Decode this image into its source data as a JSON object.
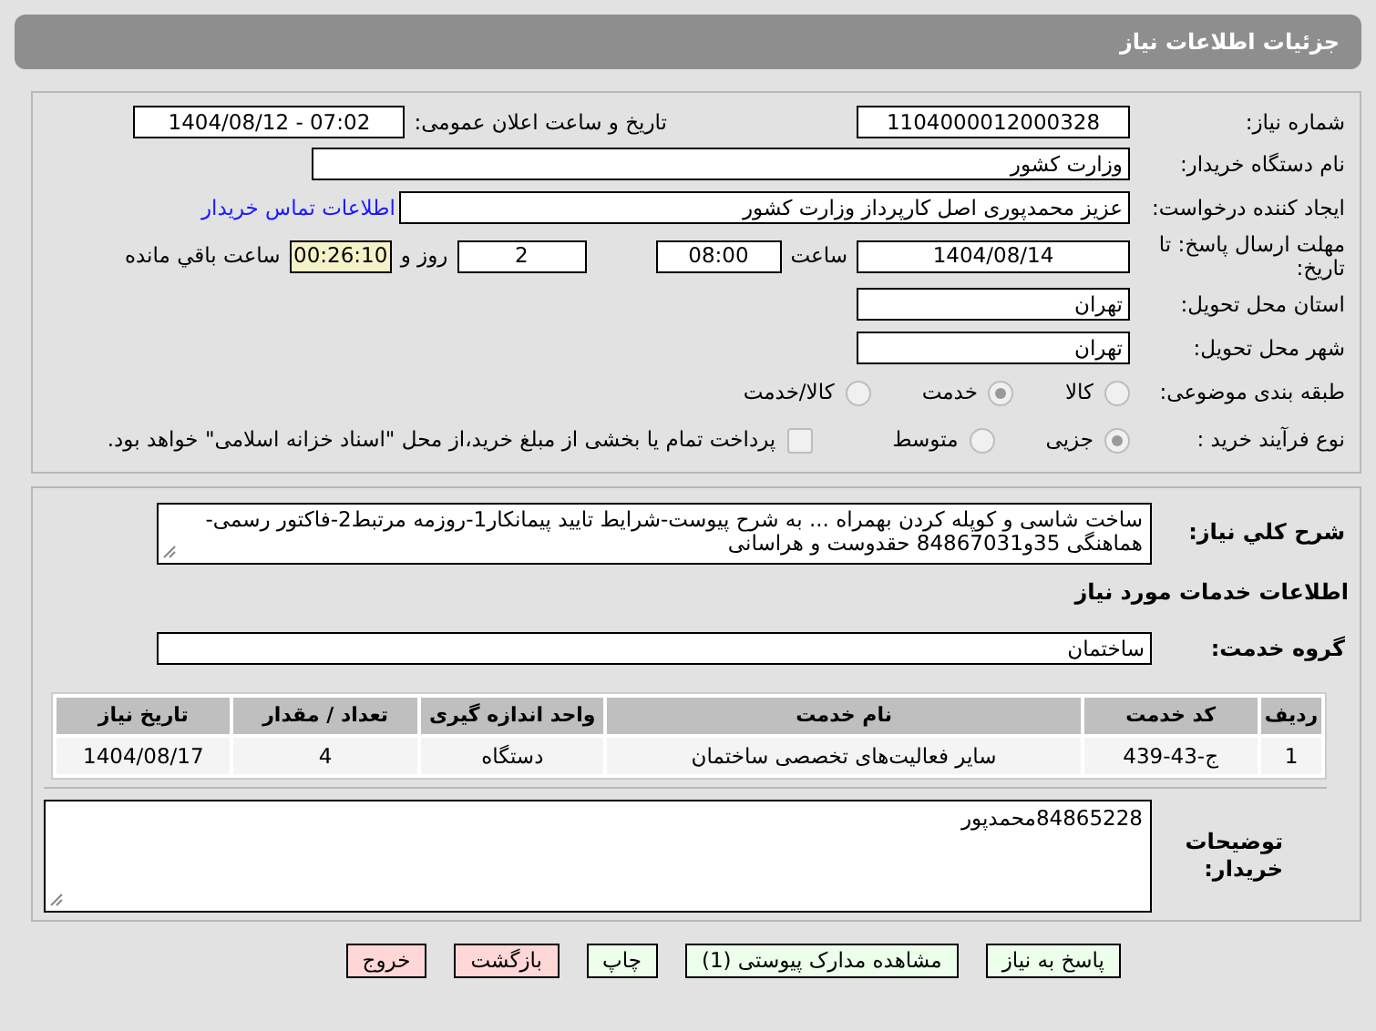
{
  "header": {
    "title": "جزئیات اطلاعات نیاز"
  },
  "need_number": {
    "label": "شماره نیاز:",
    "value": "1104000012000328"
  },
  "announce": {
    "label": "تاریخ و ساعت اعلان عمومی:",
    "value": "1404/08/12 - 07:02"
  },
  "buyer_org": {
    "label": "نام دستگاه خریدار:",
    "value": "وزارت کشور"
  },
  "requester": {
    "label": "ایجاد کننده درخواست:",
    "value": "عزیز محمدپوری اصل کارپرداز وزارت کشور",
    "link": "اطلاعات تماس خریدار"
  },
  "deadline": {
    "label": "مهلت ارسال پاسخ: تا تاریخ:",
    "date": "1404/08/14",
    "time_label": "ساعت",
    "time": "08:00",
    "days": "2",
    "days_label": "روز و",
    "remaining": "00:26:10",
    "remaining_label": "ساعت باقي مانده"
  },
  "province": {
    "label": "استان محل تحویل:",
    "value": "تهران"
  },
  "city": {
    "label": "شهر محل تحویل:",
    "value": "تهران"
  },
  "category": {
    "label": "طبقه بندی موضوعی:",
    "options": [
      {
        "label": "کالا",
        "selected": false
      },
      {
        "label": "خدمت",
        "selected": true
      },
      {
        "label": "کالا/خدمت",
        "selected": false
      }
    ]
  },
  "process": {
    "label": "نوع فرآیند خرید :",
    "options": [
      {
        "label": "جزیی",
        "selected": true
      },
      {
        "label": "متوسط",
        "selected": false
      }
    ],
    "treasury": {
      "label": "پرداخت تمام یا بخشی از مبلغ خرید،از محل \"اسناد خزانه اسلامی\" خواهد بود.",
      "checked": false
    }
  },
  "description": {
    "label": "شرح کلي نياز:",
    "value": "ساخت شاسی و کوپله کردن بهمراه ... به شرح پیوست-شرایط تایید پیمانکار1-روزمه مرتبط2-فاکتور رسمی-هماهنگی 35و84867031 حقدوست و هراسانی"
  },
  "services_heading": "اطلاعات خدمات مورد نیاز",
  "service_group": {
    "label": "گروه خدمت:",
    "value": "ساختمان"
  },
  "table": {
    "columns": [
      "ردیف",
      "کد خدمت",
      "نام خدمت",
      "واحد اندازه گیری",
      "تعداد / مقدار",
      "تاریخ نیاز"
    ],
    "rows": [
      [
        "1",
        "ج-43-439",
        "سایر فعالیت‌های تخصصی ساختمان",
        "دستگاه",
        "4",
        "1404/08/17"
      ]
    ]
  },
  "buyer_notes": {
    "label": "توضیحات خریدار:",
    "value": "84865228محمدپور"
  },
  "buttons": [
    {
      "label": "پاسخ به نیاز",
      "kind": "go"
    },
    {
      "label": "مشاهده مدارک پیوستی (1)",
      "kind": "go"
    },
    {
      "label": "چاپ",
      "kind": "go"
    },
    {
      "label": "بازگشت",
      "kind": "exit"
    },
    {
      "label": "خروج",
      "kind": "exit"
    }
  ]
}
